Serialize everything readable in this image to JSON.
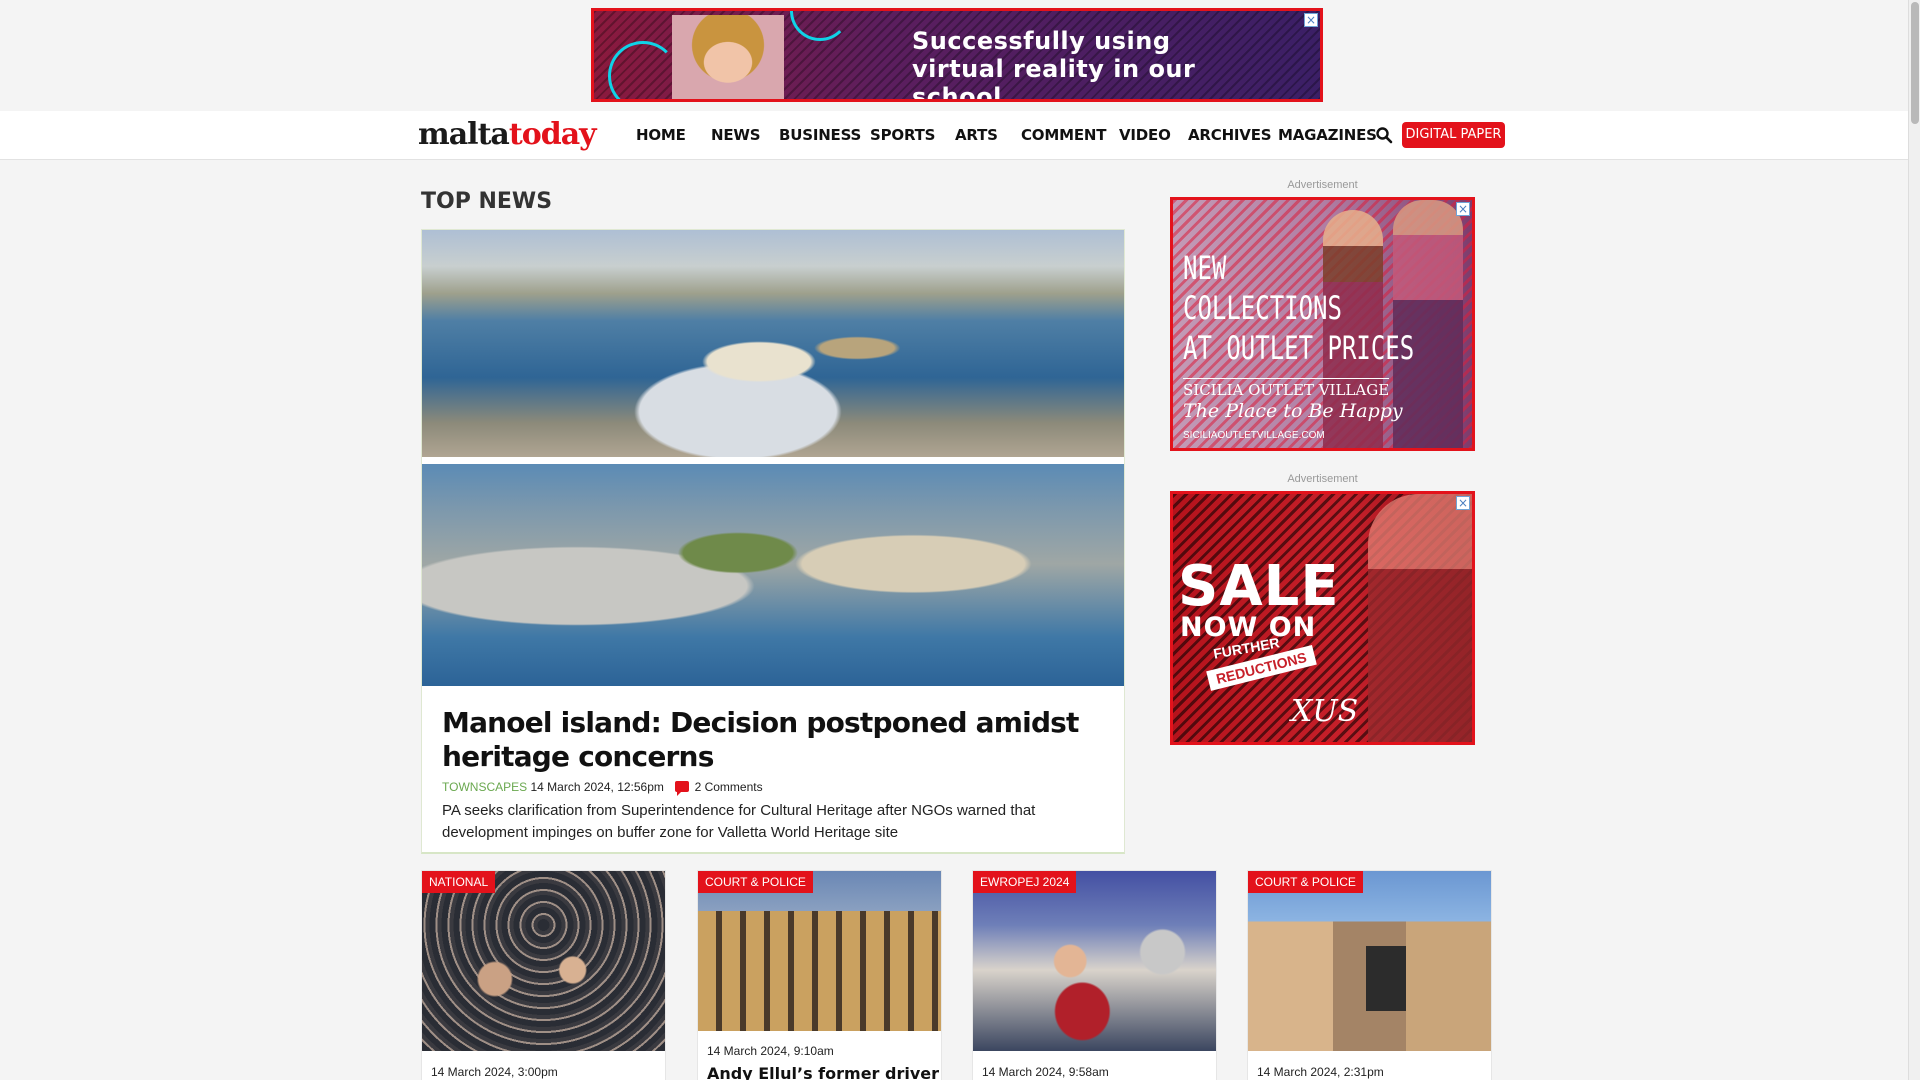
{
  "top_ad": {
    "headline_line1": "Successfully using",
    "headline_line2": "virtual reality in our school",
    "close": "×"
  },
  "header": {
    "logo_part1": "malta",
    "logo_part2": "today",
    "nav": [
      "HOME",
      "NEWS",
      "BUSINESS",
      "SPORTS",
      "ARTS",
      "COMMENT",
      "VIDEO",
      "ARCHIVES",
      "MAGAZINES"
    ],
    "digital_paper": "DIGITAL PAPER"
  },
  "top_news": {
    "section_title": "TOP NEWS",
    "headline": "Manoel island: Decision postponed amidst heritage concerns",
    "category": "TOWNSCAPES",
    "date": "14 March 2024, 12:56pm",
    "comments": "2 Comments",
    "summary": "PA seeks clarification from Superintendence for Cultural Heritage after NGOs warned that development impinges on buffer zone for Valletta World Heritage site"
  },
  "sidebar": {
    "ad_label": "Advertisement",
    "ad1": {
      "line1": "NEW",
      "line2": "COLLECTIONS",
      "line3": "AT OUTLET PRICES",
      "brand": "SICILIA OUTLET VILLAGE",
      "tagline": "The Place to Be Happy",
      "url": "SICILIAOUTLETVILLAGE.COM"
    },
    "ad2": {
      "sale": "SALE",
      "now_on": "NOW ON",
      "further": "FURTHER",
      "reductions": "REDUCTIONS",
      "brand": "XUS"
    }
  },
  "cards": [
    {
      "category": "NATIONAL",
      "date": "14 March 2024, 3:00pm",
      "title": ""
    },
    {
      "category": "COURT & POLICE",
      "date": "14 March 2024, 9:10am",
      "title": "Andy Ellul’s former driver"
    },
    {
      "category": "EWROPEJ 2024",
      "date": "14 March 2024, 9:58am",
      "title": ""
    },
    {
      "category": "COURT & POLICE",
      "date": "14 March 2024, 2:31pm",
      "title": ""
    }
  ],
  "colors": {
    "brand_red": "#e3121b",
    "category_green": "#6aa84f"
  }
}
